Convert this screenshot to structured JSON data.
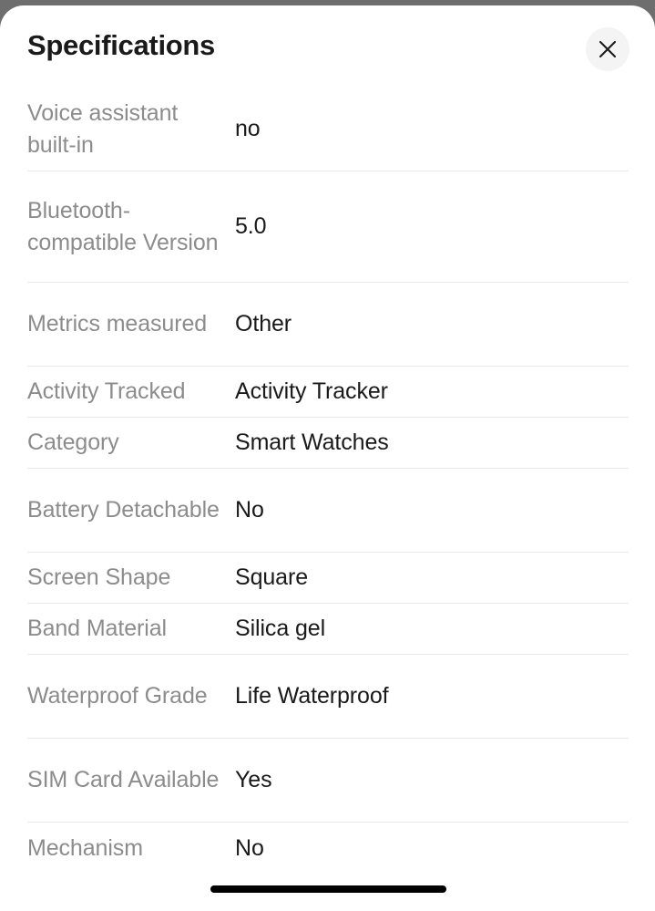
{
  "sheet": {
    "title": "Specifications",
    "close_icon": "close-icon",
    "close_label": "Close"
  },
  "specs": [
    {
      "label": "Voice assistant built-in",
      "value": "no",
      "lines": 2
    },
    {
      "label": "Bluetooth-compatible Version",
      "value": "5.0",
      "lines": 3
    },
    {
      "label": "Metrics measured",
      "value": "Other",
      "lines": 2
    },
    {
      "label": "Activity Tracked",
      "value": "Activity Tracker",
      "lines": 1
    },
    {
      "label": "Category",
      "value": "Smart Watches",
      "lines": 1
    },
    {
      "label": "Battery Detachable",
      "value": "No",
      "lines": 2
    },
    {
      "label": "Screen Shape",
      "value": "Square",
      "lines": 1
    },
    {
      "label": "Band Material",
      "value": "Silica gel",
      "lines": 1
    },
    {
      "label": "Waterproof Grade",
      "value": "Life Waterproof",
      "lines": 2
    },
    {
      "label": "SIM Card Available",
      "value": "Yes",
      "lines": 2
    },
    {
      "label": "Mechanism",
      "value": "No",
      "lines": 1
    }
  ],
  "system": {
    "home_indicator": "home-indicator"
  },
  "colors": {
    "backdrop": "#6e6e6e",
    "sheet_bg": "#ffffff",
    "label": "#8c8c8c",
    "value": "#1a1a1a",
    "divider": "#e9e9e9",
    "close_bg": "#f4f4f4"
  }
}
